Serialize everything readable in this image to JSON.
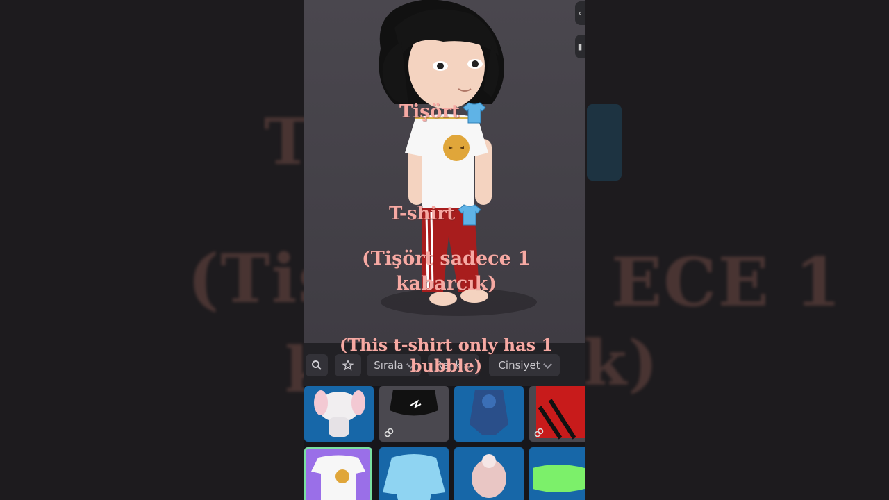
{
  "toolbar": {
    "sort_label": "Sırala",
    "color_label": "Renk",
    "gender_label": "Cinsiyet"
  },
  "caption": {
    "line1": "Tişört",
    "line2": "T-shirt",
    "line3": "(Tişört sadece 1 kabarcık)",
    "line4": "(This t-shirt only has 1 bubble)"
  },
  "colors": {
    "tile_blue": "#1767a8",
    "selected_tile": "#9a6fe8",
    "selected_outline": "#79e0a0",
    "caption_text": "#f6a9a3"
  },
  "icons": [
    "search-icon",
    "star-icon",
    "chevron-down-icon",
    "link-icon",
    "t-shirt-emoji-icon"
  ]
}
